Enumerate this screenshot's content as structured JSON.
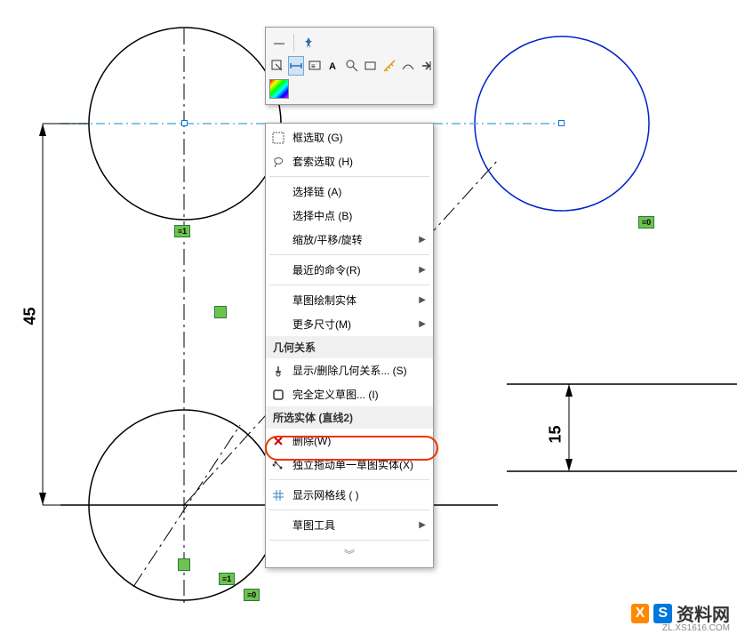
{
  "dimensions": {
    "d45": "45",
    "d15": "15"
  },
  "badges": {
    "eq1a": "≡1",
    "eq1b": "≡1",
    "eq0a": "≡0",
    "eq0b": "≡0"
  },
  "toolbar": {
    "minimize": "—",
    "pin": "pin",
    "row2": [
      "select-sketch",
      "dimension",
      "annotation",
      "label-A",
      "zoom",
      "rectangle",
      "measure",
      "curve",
      "undo",
      "exit"
    ],
    "rainbow": "color"
  },
  "menu": {
    "box_select": "框选取 (G)",
    "lasso_select": "套索选取 (H)",
    "select_chain": "选择链 (A)",
    "select_midpoint": "选择中点 (B)",
    "zoom_pan_rotate": "缩放/平移/旋转",
    "recent_cmd": "最近的命令(R)",
    "sketch_entity": "草图绘制实体",
    "more_dims": "更多尺寸(M)",
    "header_relations": "几何关系",
    "show_del_relations": "显示/删除几何关系... (S)",
    "fully_define": "完全定义草图... (I)",
    "header_selected": "所选实体 (直线2)",
    "delete": "删除(W)",
    "drag_independent": "独立拖动单一草图实体(X)",
    "show_grid": "显示网格线 ( )",
    "sketch_tools": "草图工具"
  },
  "watermark": {
    "logo_x": "X",
    "logo_s": "S",
    "text": "资料网",
    "url": "ZL.XS1616.COM"
  }
}
